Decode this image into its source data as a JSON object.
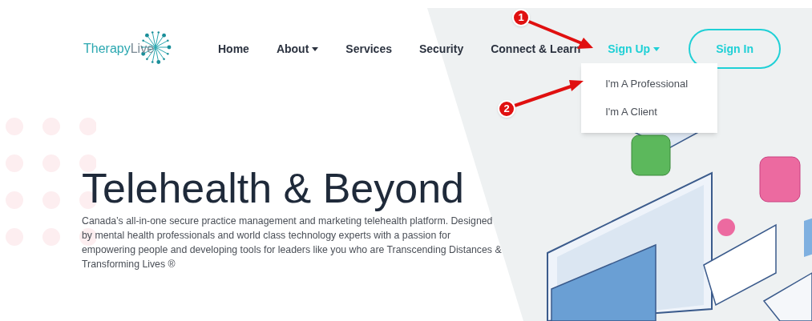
{
  "logo": {
    "name": "Therapy",
    "suffix": "Live"
  },
  "nav": [
    {
      "label": "Home",
      "has_menu": false,
      "selected": false
    },
    {
      "label": "About",
      "has_menu": true,
      "selected": false
    },
    {
      "label": "Services",
      "has_menu": false,
      "selected": false
    },
    {
      "label": "Security",
      "has_menu": false,
      "selected": false
    },
    {
      "label": "Connect & Learn",
      "has_menu": false,
      "selected": false
    },
    {
      "label": "Sign Up",
      "has_menu": true,
      "selected": true
    }
  ],
  "sign_in": "Sign In",
  "dropdown": {
    "open": true,
    "items": [
      {
        "label": "I'm A Professional"
      },
      {
        "label": "I'm A Client"
      }
    ]
  },
  "hero": {
    "title": "Telehealth & Beyond",
    "description": "Canada’s all-in-one secure practice management and marketing telehealth platform. Designed by mental health professionals and world class technology experts with a passion for empowering people and developing tools for leaders like you who are Transcending Distances & Transforming Lives ®"
  },
  "annotations": [
    {
      "number": "1"
    },
    {
      "number": "2"
    }
  ]
}
